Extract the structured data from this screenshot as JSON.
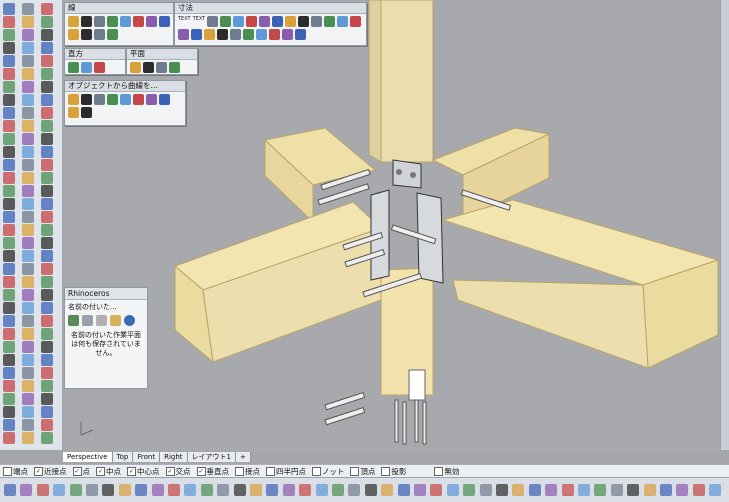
{
  "panels": {
    "lines": {
      "title": "線"
    },
    "dimension": {
      "title": "寸法",
      "text_icon_1": "TEXT",
      "text_icon_2": "TEXT"
    },
    "cuboid": {
      "title": "直方"
    },
    "plane": {
      "title": "平面"
    },
    "curve_from_object": {
      "title": "オブジェクトから曲線を..."
    }
  },
  "rhino_panel": {
    "title": "Rhinoceros",
    "subtitle": "名前の付いた...",
    "message": "名前の付いた作業平面は何も保存されていません。"
  },
  "viewport_tabs": [
    "Perspective",
    "Top",
    "Front",
    "Right",
    "レイアウト1",
    "+"
  ],
  "osnap": [
    {
      "label": "端点",
      "checked": false
    },
    {
      "label": "近接点",
      "checked": true
    },
    {
      "label": "点",
      "checked": true
    },
    {
      "label": "中点",
      "checked": true
    },
    {
      "label": "中心点",
      "checked": true
    },
    {
      "label": "交点",
      "checked": true
    },
    {
      "label": "垂直点",
      "checked": true
    },
    {
      "label": "接点",
      "checked": false
    },
    {
      "label": "四半円点",
      "checked": false
    },
    {
      "label": "ノット",
      "checked": false
    },
    {
      "label": "頂点",
      "checked": false
    },
    {
      "label": "投影",
      "checked": false
    },
    {
      "label": "無効",
      "checked": false
    }
  ],
  "colors": {
    "wood": "#f2e3ad",
    "wood_edge": "#b9a46a",
    "metal": "#cfd2d6",
    "bolt": "#eeeeee"
  }
}
